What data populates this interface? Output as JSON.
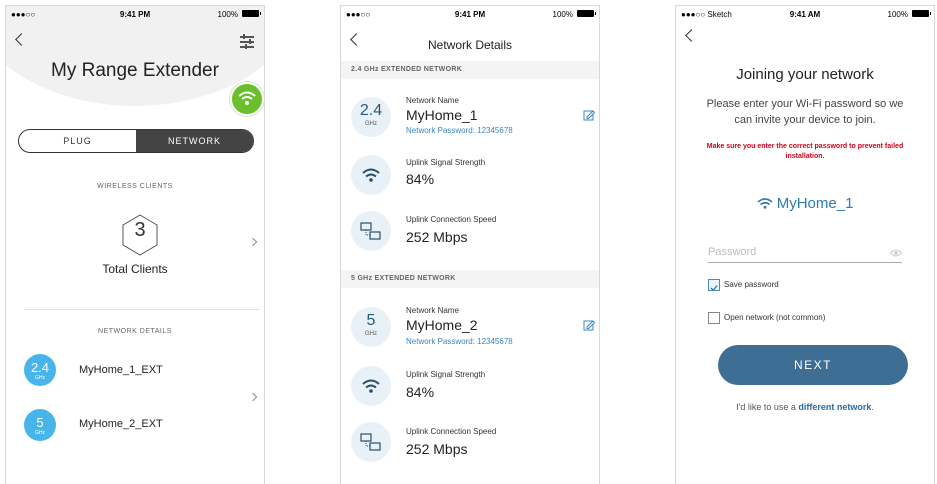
{
  "screen1": {
    "status": {
      "carrier": "●●●○○ ",
      "time": "9:41 PM",
      "battery": "100%"
    },
    "title": "My Range Extender",
    "segment": {
      "left": "PLUG",
      "right": "NETWORK"
    },
    "wireless_clients_header": "WIRELESS CLIENTS",
    "clients_count": "3",
    "clients_label": "Total Clients",
    "network_details_header": "NETWORK DETAILS",
    "networks": [
      {
        "band": "2.4",
        "unit": "GHz",
        "name": "MyHome_1_EXT"
      },
      {
        "band": "5",
        "unit": "GHz",
        "name": "MyHome_2_EXT"
      }
    ],
    "colors": {
      "accent": "#47b5ea",
      "badge": "#6abf2b"
    }
  },
  "screen2": {
    "status": {
      "carrier": "●●●○○ ",
      "time": "9:41 PM",
      "battery": "100%"
    },
    "title": "Network Details",
    "bands": [
      {
        "header": "2.4 GHz EXTENDED NETWORK",
        "band": "2.4",
        "unit": "GHz",
        "name_label": "Network Name",
        "name": "MyHome_1",
        "password": "Network Password: 12345678",
        "signal_label": "Uplink Signal Strength",
        "signal": "84%",
        "speed_label": "Uplink Connection Speed",
        "speed": "252 Mbps"
      },
      {
        "header": "5 GHz EXTENDED NETWORK",
        "band": "5",
        "unit": "GHz",
        "name_label": "Network Name",
        "name": "MyHome_2",
        "password": "Network Password: 12345678",
        "signal_label": "Uplink Signal Strength",
        "signal": "84%",
        "speed_label": "Uplink Connection Speed",
        "speed": "252 Mbps"
      }
    ]
  },
  "screen3": {
    "status": {
      "carrier": "●●●○○ Sketch ",
      "time": "9:41 AM",
      "battery": "100%"
    },
    "title": "Joining your network",
    "subtitle": "Please enter your Wi-Fi password so we can invite your device to join.",
    "warning": "Make sure you enter the correct password to prevent failed installation.",
    "ssid": "MyHome_1",
    "password_placeholder": "Password",
    "save_password": "Save password",
    "open_network": "Open network (not common)",
    "next": "NEXT",
    "footer_text": "I'd like to use a ",
    "footer_link": "different network",
    "footer_end": "."
  }
}
